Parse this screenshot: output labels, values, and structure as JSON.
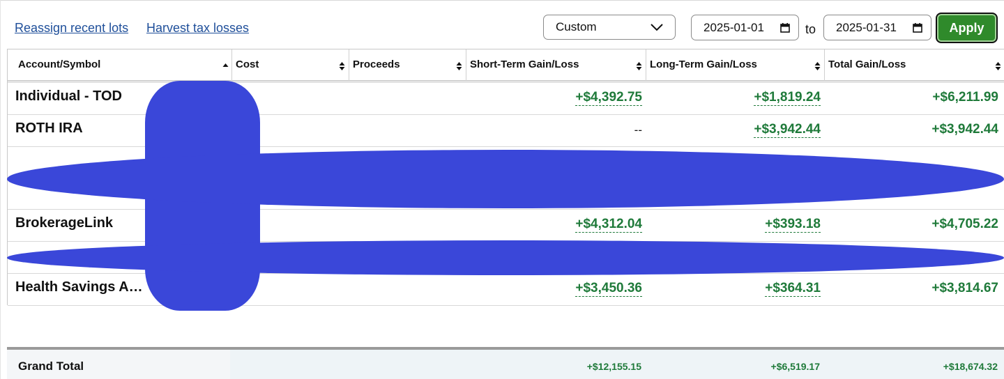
{
  "links": {
    "reassign": "Reassign recent lots",
    "harvest": "Harvest tax losses"
  },
  "filter": {
    "period": "Custom",
    "start_date": "2025-01-01",
    "to_label": "to",
    "end_date": "2025-01-31",
    "apply_label": "Apply"
  },
  "table": {
    "columns": [
      "Account/Symbol",
      "Cost",
      "Proceeds",
      "Short-Term Gain/Loss",
      "Long-Term Gain/Loss",
      "Total Gain/Loss"
    ],
    "rows": [
      {
        "name": "Individual - TOD",
        "short_term": "+$4,392.75",
        "long_term": "+$1,819.24",
        "total": "+$6,211.99"
      },
      {
        "name": "ROTH IRA",
        "short_term": "--",
        "long_term": "+$3,942.44",
        "total": "+$3,942.44"
      },
      {
        "name": "BrokerageLink",
        "short_term": "+$4,312.04",
        "long_term": "+$393.18",
        "total": "+$4,705.22"
      },
      {
        "name": "Health Savings A…",
        "short_term": "+$3,450.36",
        "long_term": "+$364.31",
        "total": "+$3,814.67"
      }
    ],
    "grand_total": {
      "label": "Grand Total",
      "short_term": "+$12,155.15",
      "long_term": "+$6,519.17",
      "total": "+$18,674.32"
    }
  },
  "colors": {
    "gain": "#1f7a3a",
    "apply": "#2f8a2b",
    "link": "#1f4f9a",
    "redaction": "#3a47d9"
  }
}
